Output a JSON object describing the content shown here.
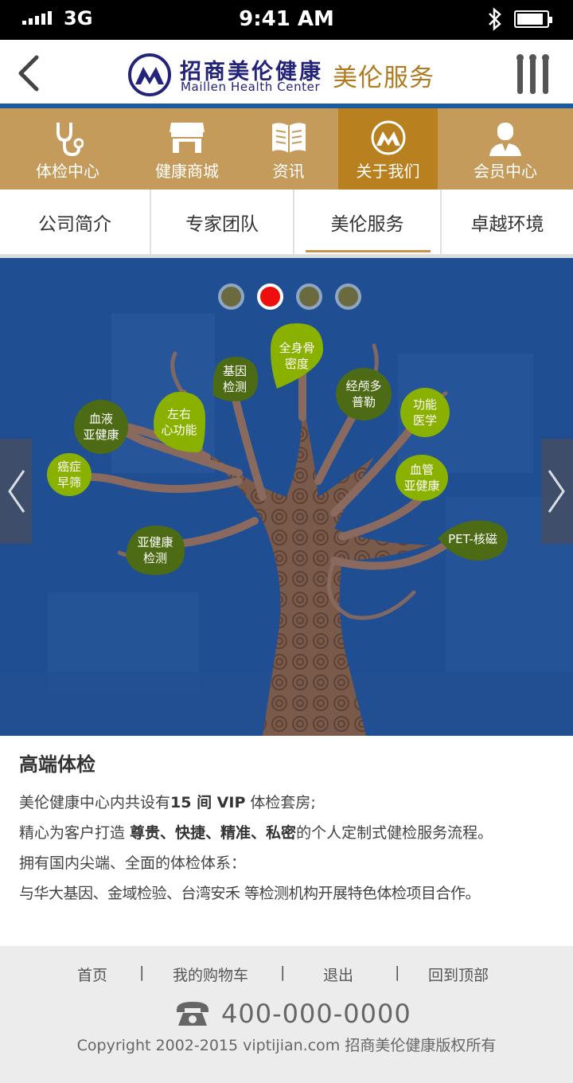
{
  "status_bar": {
    "network": "3G",
    "time": "9:41 AM",
    "battery_level": 0.9
  },
  "header": {
    "logo_cn": "招商美伦健康",
    "logo_en": "Maillen Health Center",
    "page_title": "美伦服务",
    "back_icon": "chevron-left-icon",
    "menu_icon": "three-bar-menu-icon"
  },
  "main_nav": [
    {
      "label": "体检中心",
      "icon": "stethoscope-icon",
      "active": false
    },
    {
      "label": "健康商城",
      "icon": "shop-icon",
      "active": false
    },
    {
      "label": "资讯",
      "icon": "book-icon",
      "active": false
    },
    {
      "label": "关于我们",
      "icon": "brand-logo-icon",
      "active": true
    },
    {
      "label": "会员中心",
      "icon": "user-icon",
      "active": false
    }
  ],
  "sub_tabs": [
    {
      "label": "公司简介",
      "active": false
    },
    {
      "label": "专家团队",
      "active": false
    },
    {
      "label": "美伦服务",
      "active": true
    },
    {
      "label": "卓越环境",
      "active": false
    }
  ],
  "banner": {
    "slide_count": 4,
    "active_slide": 2,
    "leaves": [
      "全身骨\n密度",
      "基因\n检测",
      "经颅多\n普勒",
      "左右\n心功能",
      "血液\n亚健康",
      "功能\n医学",
      "癌症\n早筛",
      "血管\n亚健康",
      "亚健康\n检测",
      "PET-核磁"
    ]
  },
  "content": {
    "title": "高端体检",
    "line1_a": "美伦健康中心内共设有",
    "line1_b": "15 间 VIP",
    "line1_c": " 体检套房;",
    "line2_a": "精心为客户打造 ",
    "line2_b": "尊贵、快捷、精准、私密",
    "line2_c": "的个人定制式健检服务流程。",
    "line3": "拥有国内尖端、全面的体检体系：",
    "line4": "与华大基因、金域检验、台湾安禾 等检测机构开展特色体检项目合作。"
  },
  "footer": {
    "links": [
      "首页",
      "我的购物车",
      "退出",
      "回到顶部"
    ],
    "separator": "|",
    "phone": "400-000-0000",
    "copyright": "Copyright 2002-2015 viptijian.com  招商美伦健康版权所有"
  },
  "colors": {
    "nav_bg": "#c59b5b",
    "nav_active": "#b8801e",
    "brand_blue": "#1b5a9d",
    "title_gold": "#b07a1e",
    "banner_bg": "#1f4e93"
  }
}
